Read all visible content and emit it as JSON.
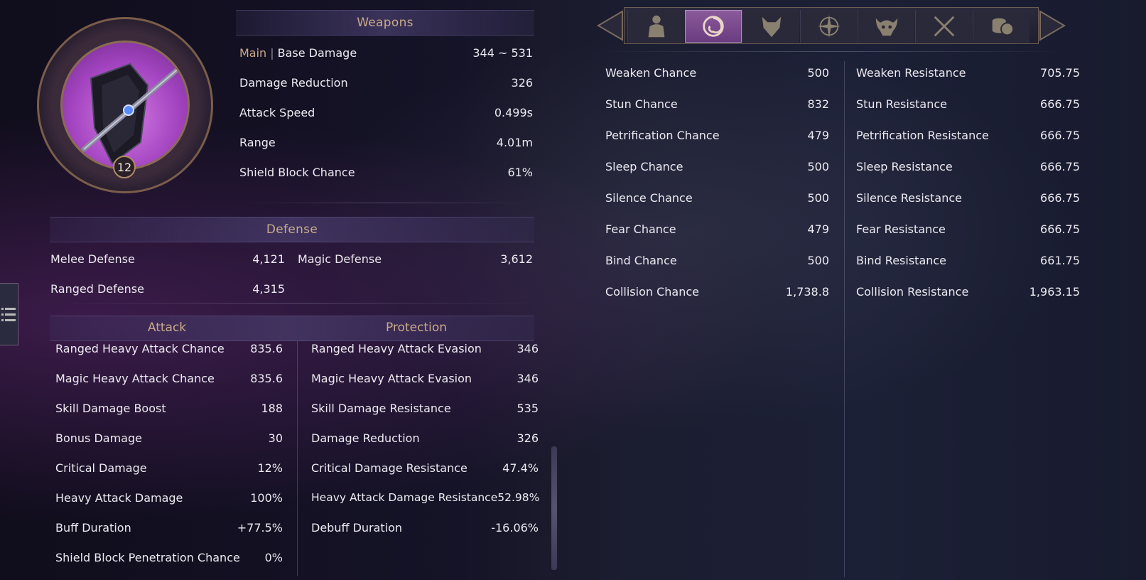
{
  "portrait": {
    "level": "12"
  },
  "weapons": {
    "header": "Weapons",
    "main_tag": "Main",
    "rows": [
      {
        "label": "Base Damage",
        "value": "344 ~ 531"
      },
      {
        "label": "Damage Reduction",
        "value": "326"
      },
      {
        "label": "Attack Speed",
        "value": "0.499s"
      },
      {
        "label": "Range",
        "value": "4.01m"
      },
      {
        "label": "Shield Block Chance",
        "value": "61%"
      }
    ]
  },
  "defense": {
    "header": "Defense",
    "melee": {
      "label": "Melee Defense",
      "value": "4,121"
    },
    "magic": {
      "label": "Magic Defense",
      "value": "3,612"
    },
    "ranged": {
      "label": "Ranged Defense",
      "value": "4,315"
    }
  },
  "attack": {
    "header": "Attack",
    "rows": [
      {
        "label": "Ranged Heavy Attack Chance",
        "value": "835.6"
      },
      {
        "label": "Magic Heavy Attack Chance",
        "value": "835.6"
      },
      {
        "label": "Skill Damage Boost",
        "value": "188"
      },
      {
        "label": "Bonus Damage",
        "value": "30"
      },
      {
        "label": "Critical Damage",
        "value": "12%"
      },
      {
        "label": "Heavy Attack Damage",
        "value": "100%"
      },
      {
        "label": "Buff Duration",
        "value": "+77.5%"
      },
      {
        "label": "Shield Block Penetration Chance",
        "value": "0%"
      }
    ]
  },
  "protection": {
    "header": "Protection",
    "rows": [
      {
        "label": "Ranged Heavy Attack Evasion",
        "value": "346"
      },
      {
        "label": "Magic Heavy Attack Evasion",
        "value": "346"
      },
      {
        "label": "Skill Damage Resistance",
        "value": "535"
      },
      {
        "label": "Damage Reduction",
        "value": "326"
      },
      {
        "label": "Critical Damage Resistance",
        "value": "47.4%"
      },
      {
        "label": "Heavy Attack Damage Resistance",
        "value": "52.98%"
      },
      {
        "label": "Debuff Duration",
        "value": "-16.06%"
      }
    ]
  },
  "tabs": [
    {
      "icon": "body-icon",
      "active": false
    },
    {
      "icon": "swirl-icon",
      "active": true
    },
    {
      "icon": "wolf-icon",
      "active": false
    },
    {
      "icon": "compass-icon",
      "active": false
    },
    {
      "icon": "demon-skull-icon",
      "active": false
    },
    {
      "icon": "crossed-swords-icon",
      "active": false
    },
    {
      "icon": "coins-icon",
      "active": false
    }
  ],
  "status_chance": [
    {
      "label": "Weaken Chance",
      "value": "500"
    },
    {
      "label": "Stun Chance",
      "value": "832"
    },
    {
      "label": "Petrification Chance",
      "value": "479"
    },
    {
      "label": "Sleep Chance",
      "value": "500"
    },
    {
      "label": "Silence Chance",
      "value": "500"
    },
    {
      "label": "Fear Chance",
      "value": "479"
    },
    {
      "label": "Bind Chance",
      "value": "500"
    },
    {
      "label": "Collision Chance",
      "value": "1,738.8"
    }
  ],
  "status_resistance": [
    {
      "label": "Weaken Resistance",
      "value": "705.75"
    },
    {
      "label": "Stun Resistance",
      "value": "666.75"
    },
    {
      "label": "Petrification Resistance",
      "value": "666.75"
    },
    {
      "label": "Sleep Resistance",
      "value": "666.75"
    },
    {
      "label": "Silence Resistance",
      "value": "666.75"
    },
    {
      "label": "Fear Resistance",
      "value": "666.75"
    },
    {
      "label": "Bind Resistance",
      "value": "661.75"
    },
    {
      "label": "Collision Resistance",
      "value": "1,963.15"
    }
  ],
  "colors": {
    "accent_gold": "#c9a98a",
    "active_tab": "#7a4a8e",
    "text": "#eceaf0"
  }
}
